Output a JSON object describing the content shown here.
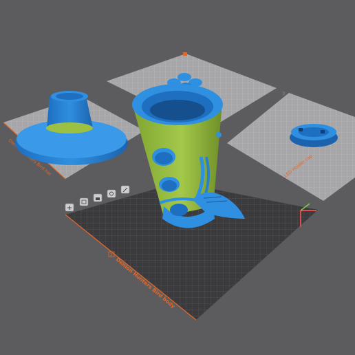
{
  "app": {
    "view": "3D slicer workspace"
  },
  "plates": {
    "active": {
      "label": "Demon Hunters Bird body",
      "index": "2"
    },
    "left": {
      "label": "Demon Hunters Bird hat"
    },
    "right": {
      "label": "LED Holder cap",
      "index": "3"
    },
    "back": {
      "label": ""
    }
  },
  "colors": {
    "background": "#5c5c5f",
    "inactive_plate": "#a7a7aa",
    "active_plate": "#3b3b3e",
    "label_orange": "#e2672a",
    "model_blue": "#2f8fe0",
    "model_green": "#9cc043"
  },
  "plate_tool_icons": [
    "orient-icon",
    "arrange-icon",
    "lock-icon",
    "settings-icon",
    "edit-icon"
  ]
}
